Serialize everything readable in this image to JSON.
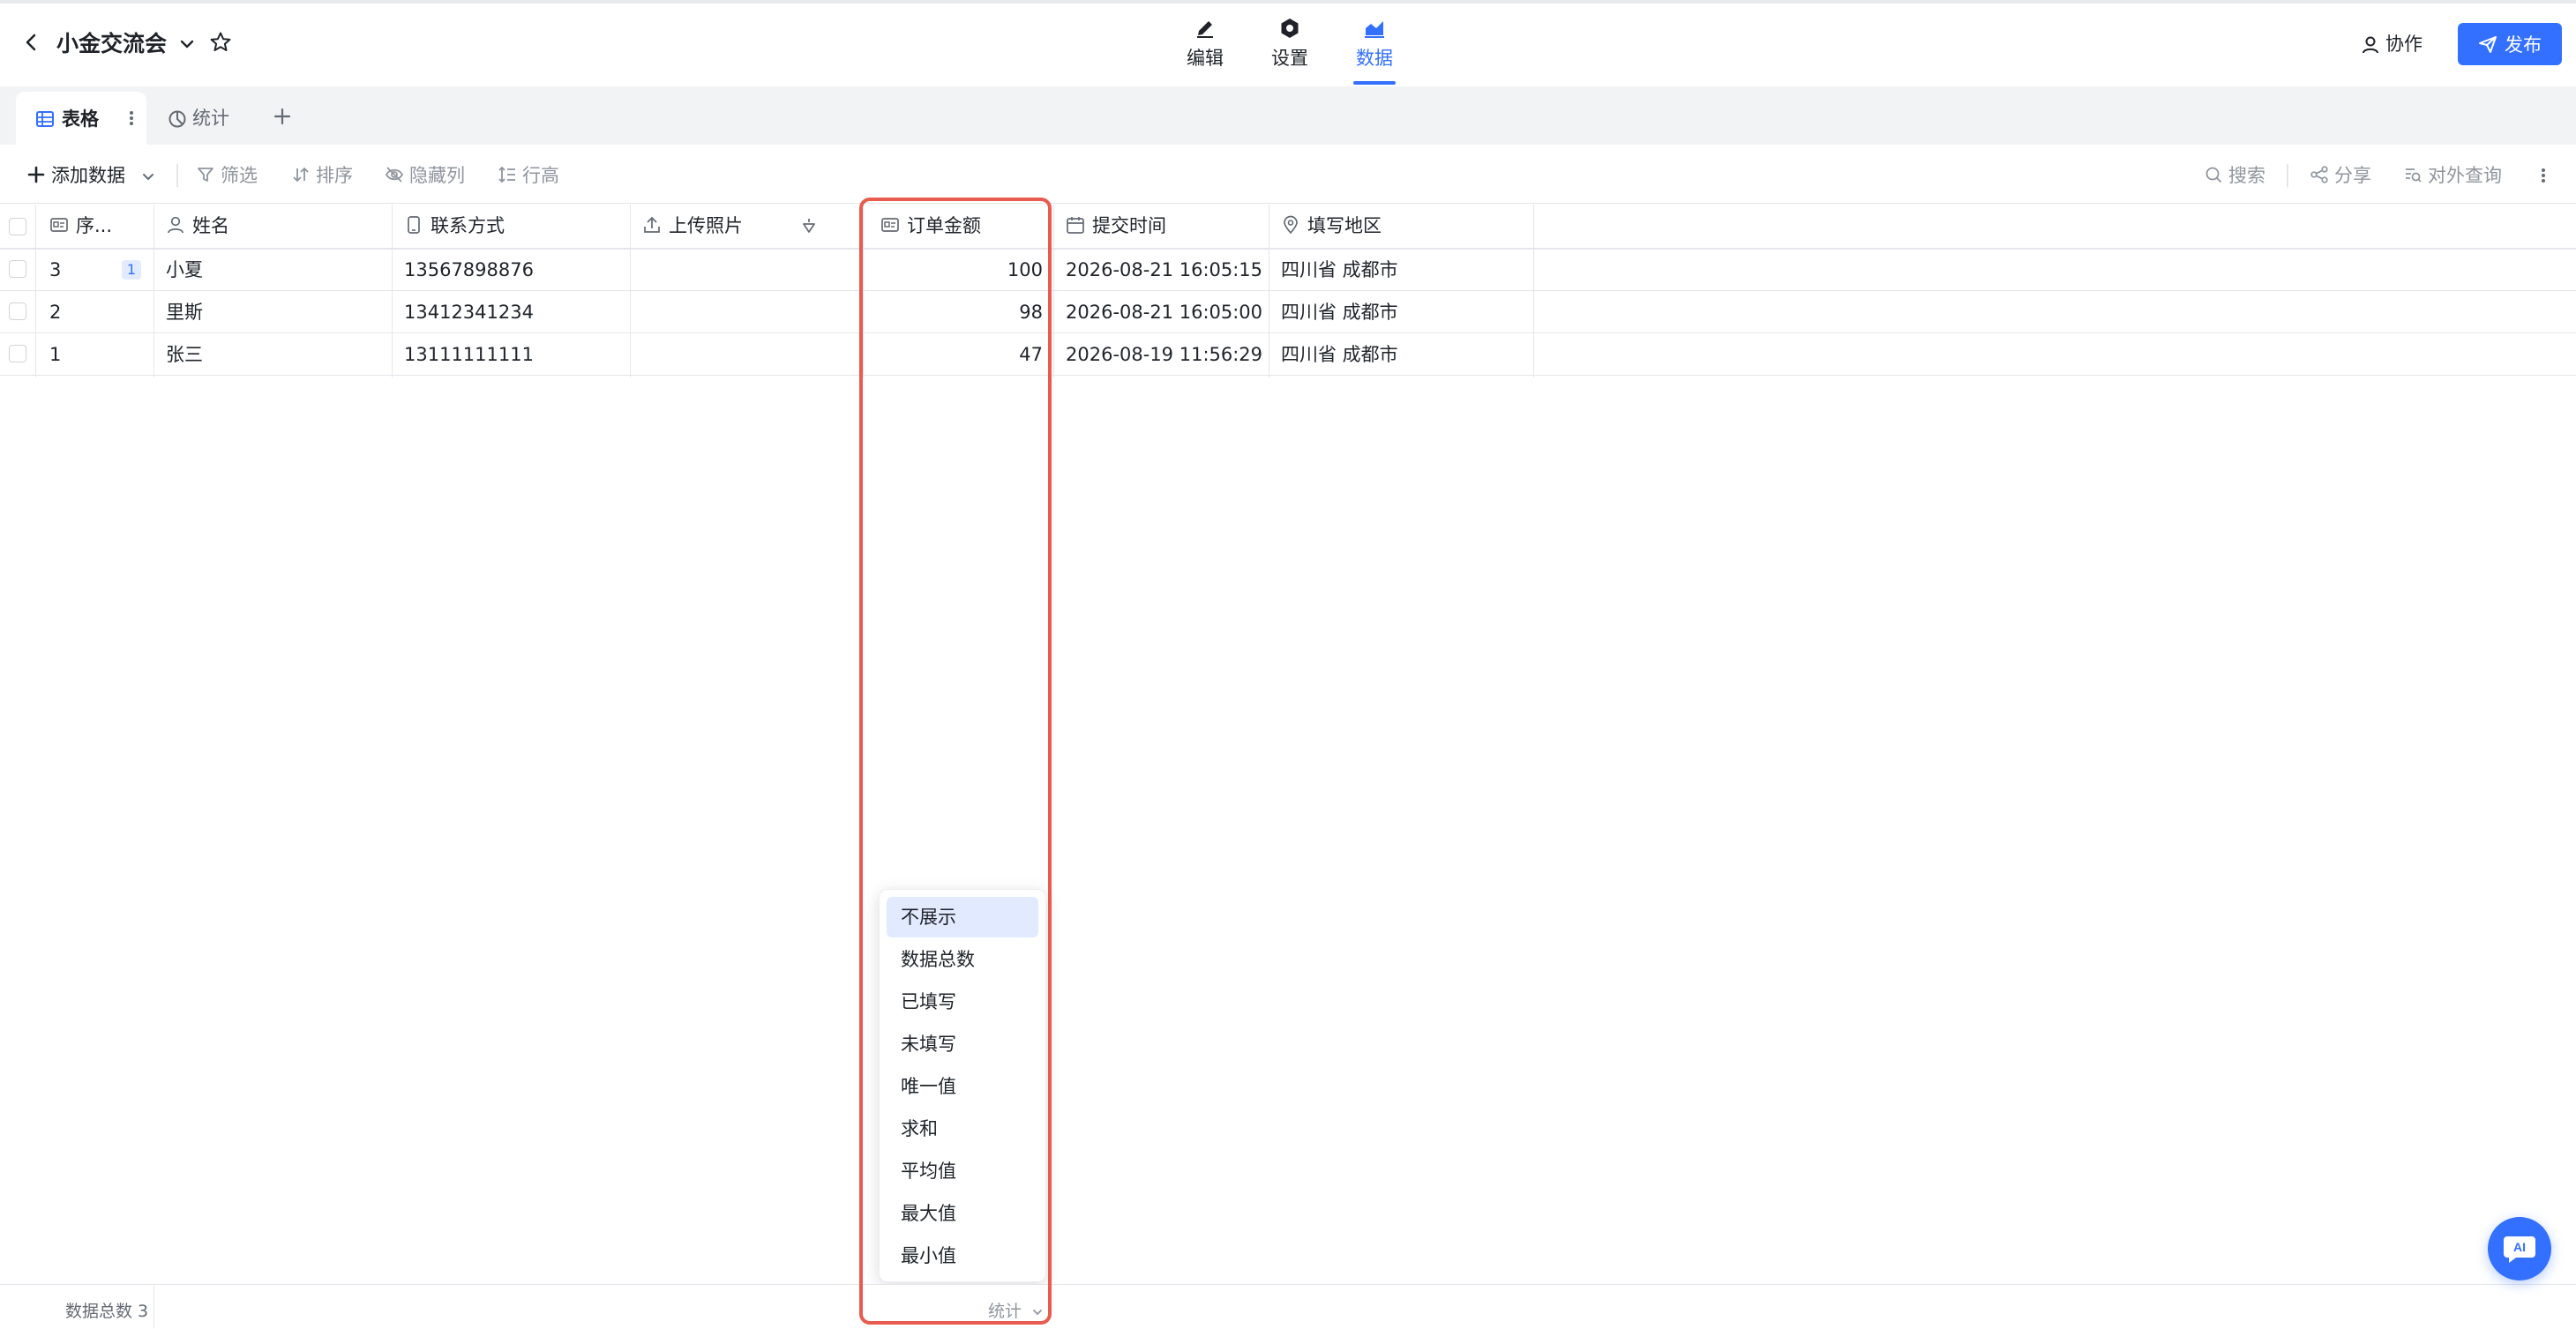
{
  "header": {
    "title": "小金交流会",
    "nav": [
      {
        "label": "编辑",
        "icon": "edit-icon"
      },
      {
        "label": "设置",
        "icon": "settings-icon"
      },
      {
        "label": "数据",
        "icon": "chart-icon",
        "active": true
      }
    ],
    "collab_label": "协作",
    "publish_label": "发布"
  },
  "tabs": [
    {
      "label": "表格",
      "icon": "table-icon",
      "active": true
    },
    {
      "label": "统计",
      "icon": "pie-chart-icon"
    }
  ],
  "toolbar": {
    "add_data": "添加数据",
    "filter": "筛选",
    "sort": "排序",
    "hide_columns": "隐藏列",
    "row_height": "行高",
    "search": "搜索",
    "share": "分享",
    "external_query": "对外查询"
  },
  "table": {
    "columns": [
      "序...",
      "姓名",
      "联系方式",
      "上传照片",
      "订单金额",
      "提交时间",
      "填写地区"
    ],
    "rows": [
      {
        "seq": "3",
        "badge": "1",
        "name": "小夏",
        "phone": "13567898876",
        "photo": "",
        "amount": "100",
        "time": "2026-08-21 16:05:15",
        "region": "四川省 成都市"
      },
      {
        "seq": "2",
        "badge": "",
        "name": "里斯",
        "phone": "13412341234",
        "photo": "",
        "amount": "98",
        "time": "2026-08-21 16:05:00",
        "region": "四川省 成都市"
      },
      {
        "seq": "1",
        "badge": "",
        "name": "张三",
        "phone": "13111111111",
        "photo": "",
        "amount": "47",
        "time": "2026-08-19 11:56:29",
        "region": "四川省 成都市"
      }
    ]
  },
  "dropdown": {
    "options": [
      "不展示",
      "数据总数",
      "已填写",
      "未填写",
      "唯一值",
      "求和",
      "平均值",
      "最大值",
      "最小值"
    ],
    "selected": "不展示"
  },
  "footer": {
    "count_label": "数据总数 3",
    "stat_label": "统计"
  },
  "ai_label": "AI",
  "colors": {
    "accent": "#3370ff",
    "highlight": "#e85b4e"
  }
}
